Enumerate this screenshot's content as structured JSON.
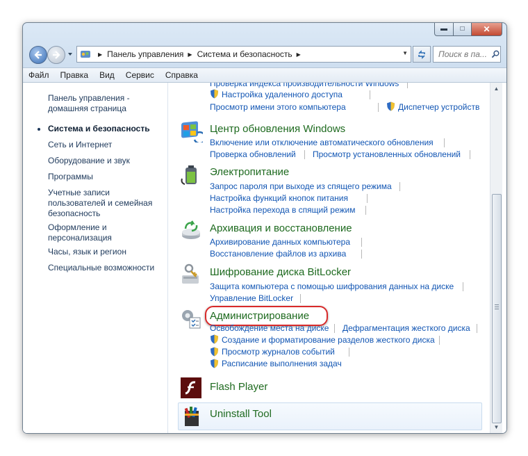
{
  "window": {
    "caption_buttons": {
      "minimize": "minimize-icon",
      "maximize": "maximize-icon",
      "close": "close-icon"
    }
  },
  "address": {
    "crumbs": [
      "Панель управления",
      "Система и безопасность"
    ],
    "search_placeholder": "Поиск в па..."
  },
  "menu": [
    "Файл",
    "Правка",
    "Вид",
    "Сервис",
    "Справка"
  ],
  "sidebar": {
    "items": [
      {
        "label": "Панель управления - домашняя страница",
        "current": false
      },
      {
        "label": "Система и безопасность",
        "current": true
      },
      {
        "label": "Сеть и Интернет",
        "current": false
      },
      {
        "label": "Оборудование и звук",
        "current": false
      },
      {
        "label": "Программы",
        "current": false
      },
      {
        "label": "Учетные записи пользователей и семейная безопасность",
        "current": false
      },
      {
        "label": "Оформление и персонализация",
        "current": false
      },
      {
        "label": "Часы, язык и регион",
        "current": false
      },
      {
        "label": "Специальные возможности",
        "current": false
      }
    ]
  },
  "main": {
    "top_links": {
      "partial": "Проверка индекса производительности Windows",
      "remote": "Настройка удаленного доступа",
      "computer_name": "Просмотр имени этого компьютера",
      "device_manager": "Диспетчер устройств"
    },
    "windows_update": {
      "title": "Центр обновления Windows",
      "link1": "Включение или отключение автоматического обновления",
      "link2": "Проверка обновлений",
      "link3": "Просмотр установленных обновлений"
    },
    "power": {
      "title": "Электропитание",
      "link1": "Запрос пароля при выходе из спящего режима",
      "link2": "Настройка функций кнопок питания",
      "link3": "Настройка перехода в спящий режим"
    },
    "backup": {
      "title": "Архивация и восстановление",
      "link1": "Архивирование данных компьютера",
      "link2": "Восстановление файлов из архива"
    },
    "bitlocker": {
      "title": "Шифрование диска BitLocker",
      "link1": "Защита компьютера с помощью шифрования данных на диске",
      "link2": "Управление BitLocker"
    },
    "admin": {
      "title": "Администрирование",
      "link1": "Освобождение места на диске",
      "link2": "Дефрагментация жесткого диска",
      "link3": "Создание и форматирование разделов жесткого диска",
      "link4": "Просмотр журналов событий",
      "link5": "Расписание выполнения задач"
    },
    "flash": {
      "title": "Flash Player"
    },
    "uninstall": {
      "title": "Uninstall Tool"
    }
  },
  "colors": {
    "category_title": "#1e6a1f",
    "link": "#1155b3",
    "highlight_ring": "#d82a2a"
  }
}
